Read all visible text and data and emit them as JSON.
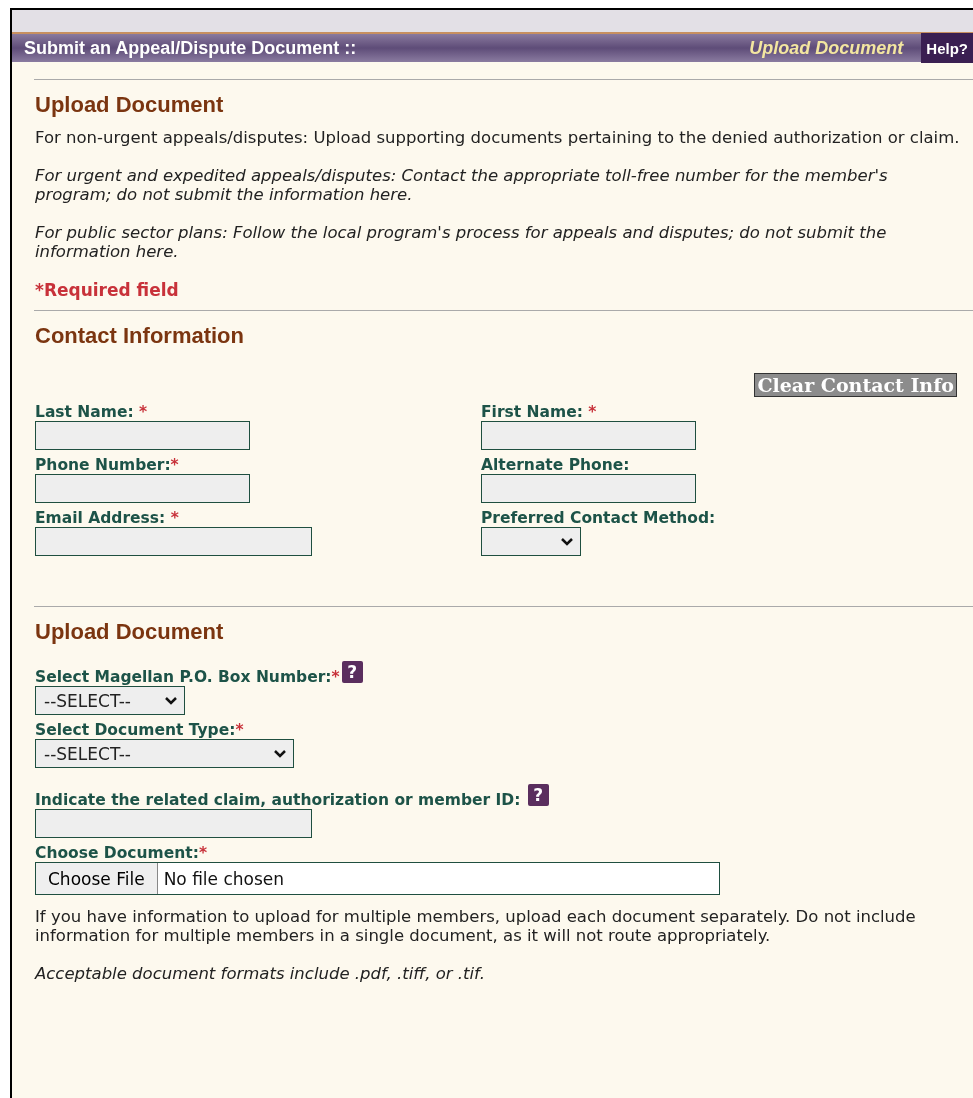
{
  "header": {
    "title": "Submit an Appeal/Dispute Document ::",
    "page": "Upload Document",
    "help": "Help?"
  },
  "intro": {
    "heading": "Upload Document",
    "paragraphs": [
      {
        "text": "For non-urgent appeals/disputes: Upload supporting documents pertaining to the denied authorization or claim.",
        "italic": false
      },
      {
        "text": "For urgent and expedited appeals/disputes: Contact the appropriate toll-free number for the member's program; do not submit the information here.",
        "italic": true
      },
      {
        "text": "For public sector plans: Follow the local program's process for appeals and disputes; do not submit the information here.",
        "italic": true
      }
    ],
    "required_note": "*Required field"
  },
  "contact": {
    "heading": "Contact Information",
    "clear_button": "Clear Contact Info",
    "fields": [
      {
        "label": "Last Name: ",
        "mark": "*",
        "kind": "text"
      },
      {
        "label": "First Name: ",
        "mark": "*",
        "kind": "text"
      },
      {
        "label": "Phone Number:",
        "mark": "*",
        "kind": "text"
      },
      {
        "label": "Alternate Phone:",
        "kind": "text"
      },
      {
        "label": "Email Address: ",
        "mark": "*",
        "kind": "text"
      },
      {
        "label": "Preferred Contact Method:",
        "kind": "select"
      }
    ]
  },
  "upload": {
    "heading": "Upload Document",
    "fields": [
      {
        "label": "Select Magellan P.O. Box Number:",
        "mark": "*",
        "help": "?",
        "kind": "select",
        "value": "--SELECT--"
      },
      {
        "label": "Select Document Type:",
        "mark": "*",
        "kind": "select",
        "value": "--SELECT--"
      },
      {
        "label": "Indicate the related claim, authorization or member ID: ",
        "help": "?",
        "kind": "text"
      },
      {
        "label": "Choose Document:",
        "mark": "*",
        "kind": "file",
        "button": "Choose File",
        "value": "No file chosen"
      }
    ],
    "notes": [
      {
        "text": "If you have information to upload for multiple members, upload each document separately. Do not include information for multiple members in a single document, as it will not route appropriately.",
        "italic": false
      },
      {
        "text": "Acceptable document formats include .pdf, .tiff, or .tif.",
        "italic": true
      }
    ]
  }
}
